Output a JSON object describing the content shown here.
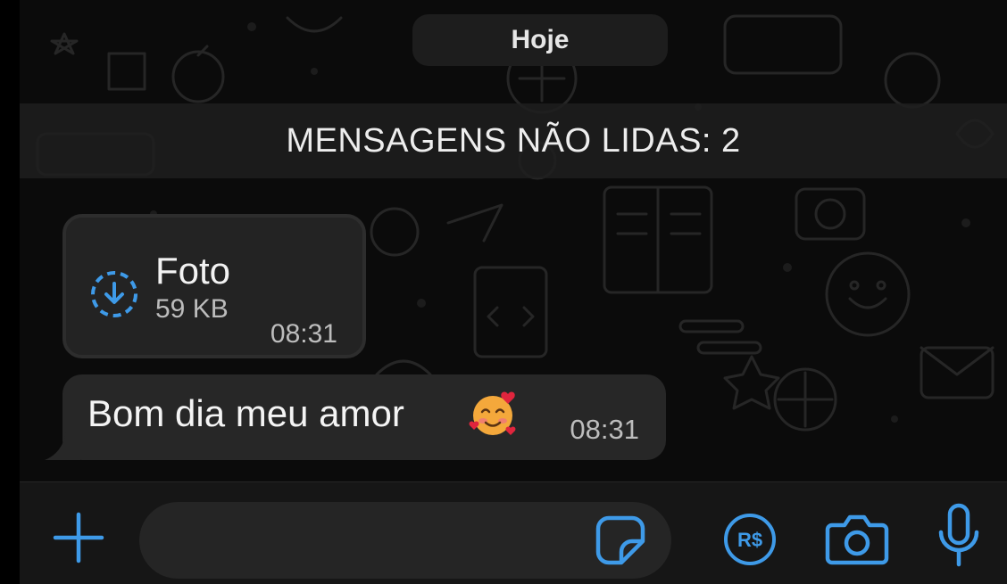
{
  "chat": {
    "date_label": "Hoje",
    "unread_banner": "MENSAGENS NÃO LIDAS: 2",
    "messages": [
      {
        "type": "photo",
        "title": "Foto",
        "size": "59 KB",
        "time": "08:31"
      },
      {
        "type": "text",
        "text": "Bom dia meu amor",
        "emoji": "smiling-face-with-hearts",
        "time": "08:31"
      }
    ]
  },
  "input_bar": {
    "field_value": "",
    "icons": [
      "plus-icon",
      "sticker-icon",
      "payment-icon",
      "camera-icon",
      "microphone-icon"
    ]
  },
  "colors": {
    "accent": "#3e9ae8",
    "bubble": "#272727",
    "background": "#0b0b0b",
    "emoji_face": "#f4a83b",
    "emoji_hearts": "#e0253d"
  }
}
